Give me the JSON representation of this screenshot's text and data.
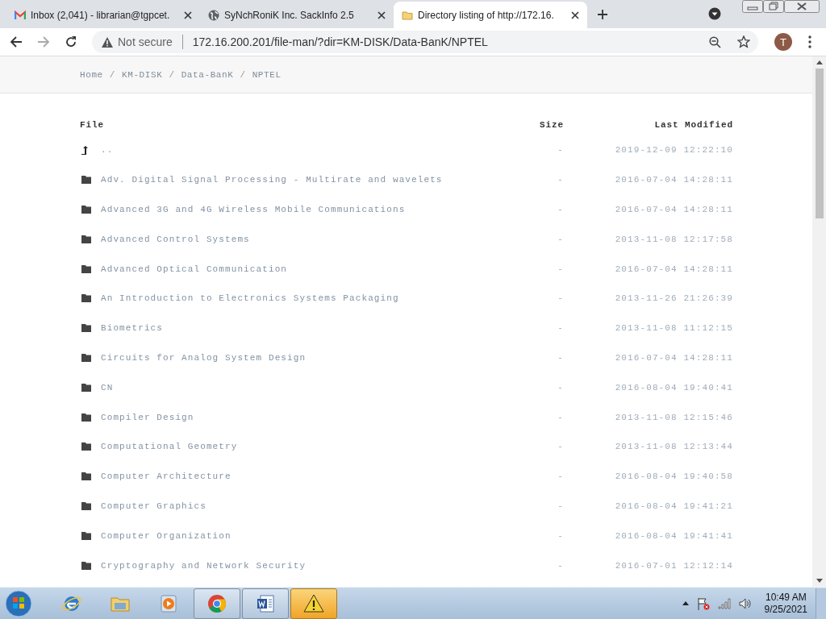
{
  "browser": {
    "tabs": [
      {
        "kind": "mail",
        "title": "Inbox (2,041) - librarian@tgpcet.",
        "selected": false
      },
      {
        "kind": "globe",
        "title": "SyNchRoniK Inc. SackInfo 2.5",
        "selected": false
      },
      {
        "kind": "folder",
        "title": "Directory listing of http://172.16.",
        "selected": true
      }
    ],
    "security": "Not secure",
    "url": "172.16.200.201/file-man/?dir=KM-DISK/Data-BanK/NPTEL",
    "profile_initial": "T"
  },
  "breadcrumb": {
    "separator": "/",
    "items": [
      "Home",
      "KM-DISK",
      "Data-BanK",
      "NPTEL"
    ]
  },
  "table": {
    "columns": [
      "File",
      "Size",
      "Last Modified"
    ],
    "rows": [
      {
        "kind": "parent",
        "name": "..",
        "size": "-",
        "modified": "2019-12-09 12:22:10"
      },
      {
        "kind": "folder",
        "name": "Adv. Digital Signal Processing - Multirate and wavelets",
        "size": "-",
        "modified": "2016-07-04 14:28:11"
      },
      {
        "kind": "folder",
        "name": "Advanced 3G and 4G Wireless Mobile Communications",
        "size": "-",
        "modified": "2016-07-04 14:28:11"
      },
      {
        "kind": "folder",
        "name": "Advanced Control Systems",
        "size": "-",
        "modified": "2013-11-08 12:17:58"
      },
      {
        "kind": "folder",
        "name": "Advanced Optical Communication",
        "size": "-",
        "modified": "2016-07-04 14:28:11"
      },
      {
        "kind": "folder",
        "name": "An Introduction to Electronics Systems Packaging",
        "size": "-",
        "modified": "2013-11-26 21:26:39"
      },
      {
        "kind": "folder",
        "name": "Biometrics",
        "size": "-",
        "modified": "2013-11-08 11:12:15"
      },
      {
        "kind": "folder",
        "name": "Circuits for Analog System Design",
        "size": "-",
        "modified": "2016-07-04 14:28:11"
      },
      {
        "kind": "folder",
        "name": "CN",
        "size": "-",
        "modified": "2016-08-04 19:40:41"
      },
      {
        "kind": "folder",
        "name": "Compiler Design",
        "size": "-",
        "modified": "2013-11-08 12:15:46"
      },
      {
        "kind": "folder",
        "name": "Computational Geometry",
        "size": "-",
        "modified": "2013-11-08 12:13:44"
      },
      {
        "kind": "folder",
        "name": "Computer Architecture",
        "size": "-",
        "modified": "2016-08-04 19:40:58"
      },
      {
        "kind": "folder",
        "name": "Computer Graphics",
        "size": "-",
        "modified": "2016-08-04 19:41:21"
      },
      {
        "kind": "folder",
        "name": "Computer Organization",
        "size": "-",
        "modified": "2016-08-04 19:41:41"
      },
      {
        "kind": "folder",
        "name": "Cryptography and Network Security",
        "size": "-",
        "modified": "2016-07-01 12:12:14"
      }
    ]
  },
  "taskbar": {
    "items": [
      {
        "kind": "ie",
        "open": false,
        "highlighted": false
      },
      {
        "kind": "explorer",
        "open": false,
        "highlighted": false
      },
      {
        "kind": "media",
        "open": false,
        "highlighted": false
      },
      {
        "kind": "chrome",
        "open": true,
        "highlighted": false
      },
      {
        "kind": "word",
        "open": true,
        "highlighted": false
      },
      {
        "kind": "warning",
        "open": true,
        "highlighted": true
      }
    ],
    "time": "10:49 AM",
    "date": "9/25/2021"
  }
}
